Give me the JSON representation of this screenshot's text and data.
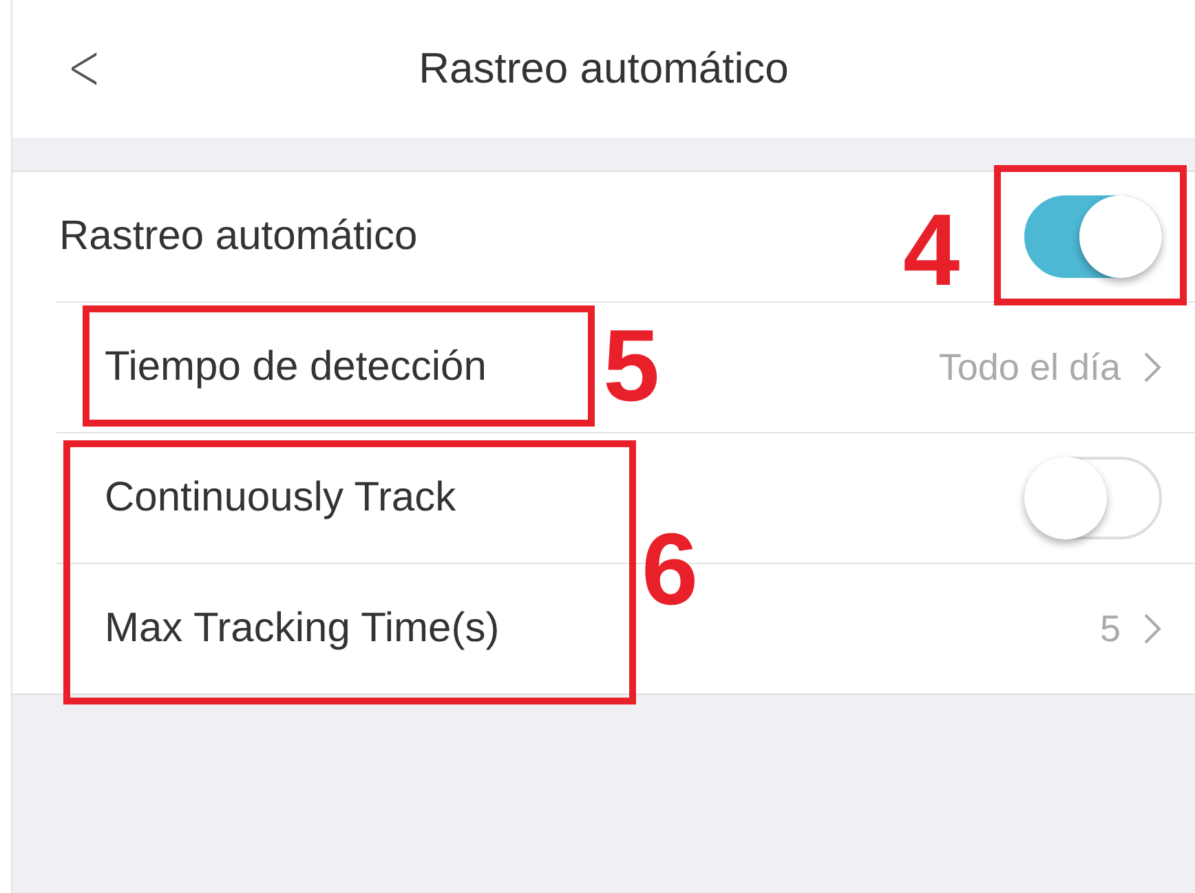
{
  "header": {
    "back": "<",
    "title": "Rastreo automático"
  },
  "rows": [
    {
      "kind": "toggle",
      "label": "Rastreo automático",
      "on": true
    },
    {
      "kind": "link",
      "label": "Tiempo de detección",
      "value": "Todo el día"
    },
    {
      "kind": "toggle",
      "label": "Continuously Track",
      "on": false
    },
    {
      "kind": "link",
      "label": "Max Tracking Time(s)",
      "value": "5"
    }
  ],
  "annotations": [
    {
      "label": "4"
    },
    {
      "label": "5"
    },
    {
      "label": "6"
    }
  ]
}
